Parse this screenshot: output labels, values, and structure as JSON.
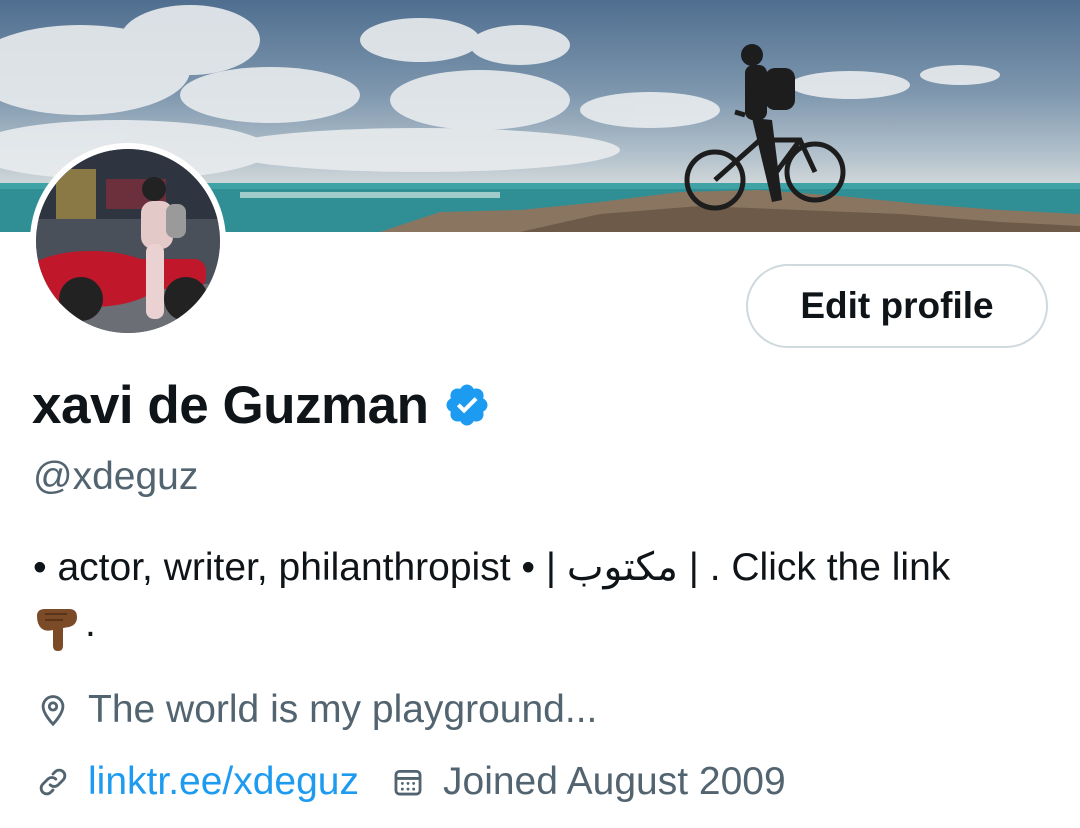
{
  "profile": {
    "display_name": "xavi de Guzman",
    "handle": "@xdeguz",
    "verified": true,
    "bio_line1": "• actor, writer, philanthropist • | مكتوب | .  Click the link",
    "bio_line2": ".",
    "bio_emoji": "backhand-index-pointing-down",
    "location": "The world is my playground...",
    "website": "linktr.ee/xdeguz",
    "joined": "Joined August 2009"
  },
  "actions": {
    "edit_profile_label": "Edit profile"
  },
  "colors": {
    "text": "#0f1419",
    "secondary": "#536471",
    "link": "#1d9bf0",
    "verified_badge": "#1d9bf0",
    "button_border": "#cfd9de"
  },
  "icons": {
    "location": "location-pin-icon",
    "website": "link-icon",
    "joined": "calendar-icon",
    "verified": "verified-badge-icon"
  }
}
